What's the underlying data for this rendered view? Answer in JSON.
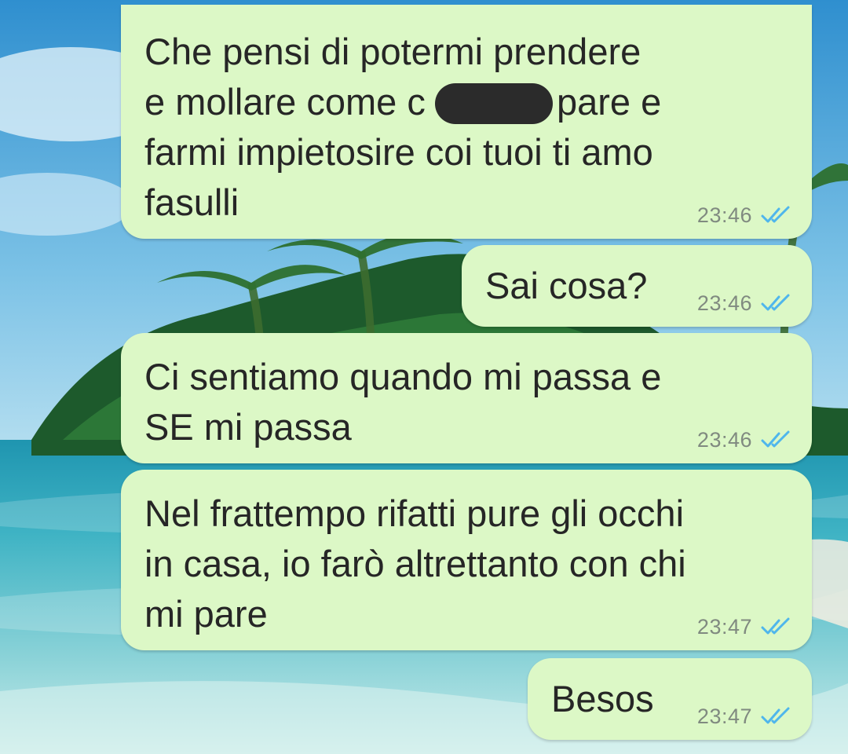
{
  "chat": {
    "messages": [
      {
        "text": "Che pensi di potermi prendere\ne mollare come c          ti pare e\nfarmi impietosire coi tuoi ti amo\nfasulli",
        "time": "23:46",
        "status": "read"
      },
      {
        "text": "Sai cosa?",
        "time": "23:46",
        "status": "read"
      },
      {
        "text": "Ci sentiamo quando mi passa e\nSE mi passa",
        "time": "23:46",
        "status": "read"
      },
      {
        "text": "Nel frattempo rifatti pure gli occhi\nin casa, io farò altrettanto con chi\nmi pare",
        "time": "23:47",
        "status": "read"
      },
      {
        "text": "Besos",
        "time": "23:47",
        "status": "read"
      }
    ]
  },
  "colors": {
    "bubble_outgoing": "#dcf8c6",
    "read_ticks": "#4fb6ec",
    "timestamp": "#808a80"
  },
  "icons": {
    "read_receipt": "double-check-icon"
  }
}
